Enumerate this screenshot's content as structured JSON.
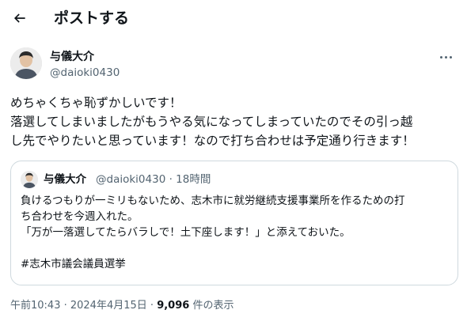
{
  "header": {
    "title": "ポストする"
  },
  "post": {
    "author_name": "与儀大介",
    "author_handle": "@daioki0430",
    "text_lines": [
      "めちゃくちゃ恥ずかしいです！",
      "落選してしまいましたがもうやる気になってしまっていたのでその引っ越",
      "し先でやりたいと思っています！なので打ち合わせは予定通り行きます！"
    ]
  },
  "quote": {
    "author_name": "与儀大介",
    "author_handle": "@daioki0430",
    "separator": "·",
    "time": "18時間",
    "lines": [
      "負けるつもりが一ミリもないため、志木市に就労継続支援事業所を作るための打",
      "ち合わせを今週入れた。",
      "「万が一落選してたらバラしで！土下座します！」と添えておいた。",
      "",
      "#志木市議会議員選挙"
    ]
  },
  "footer": {
    "timestamp": "午前10:43 · 2024年4月15日",
    "separator": "·",
    "views_count": "9,096",
    "views_label": "件の表示"
  },
  "icons": {
    "back": "arrow-left-icon",
    "more": "more-horizontal-icon"
  }
}
